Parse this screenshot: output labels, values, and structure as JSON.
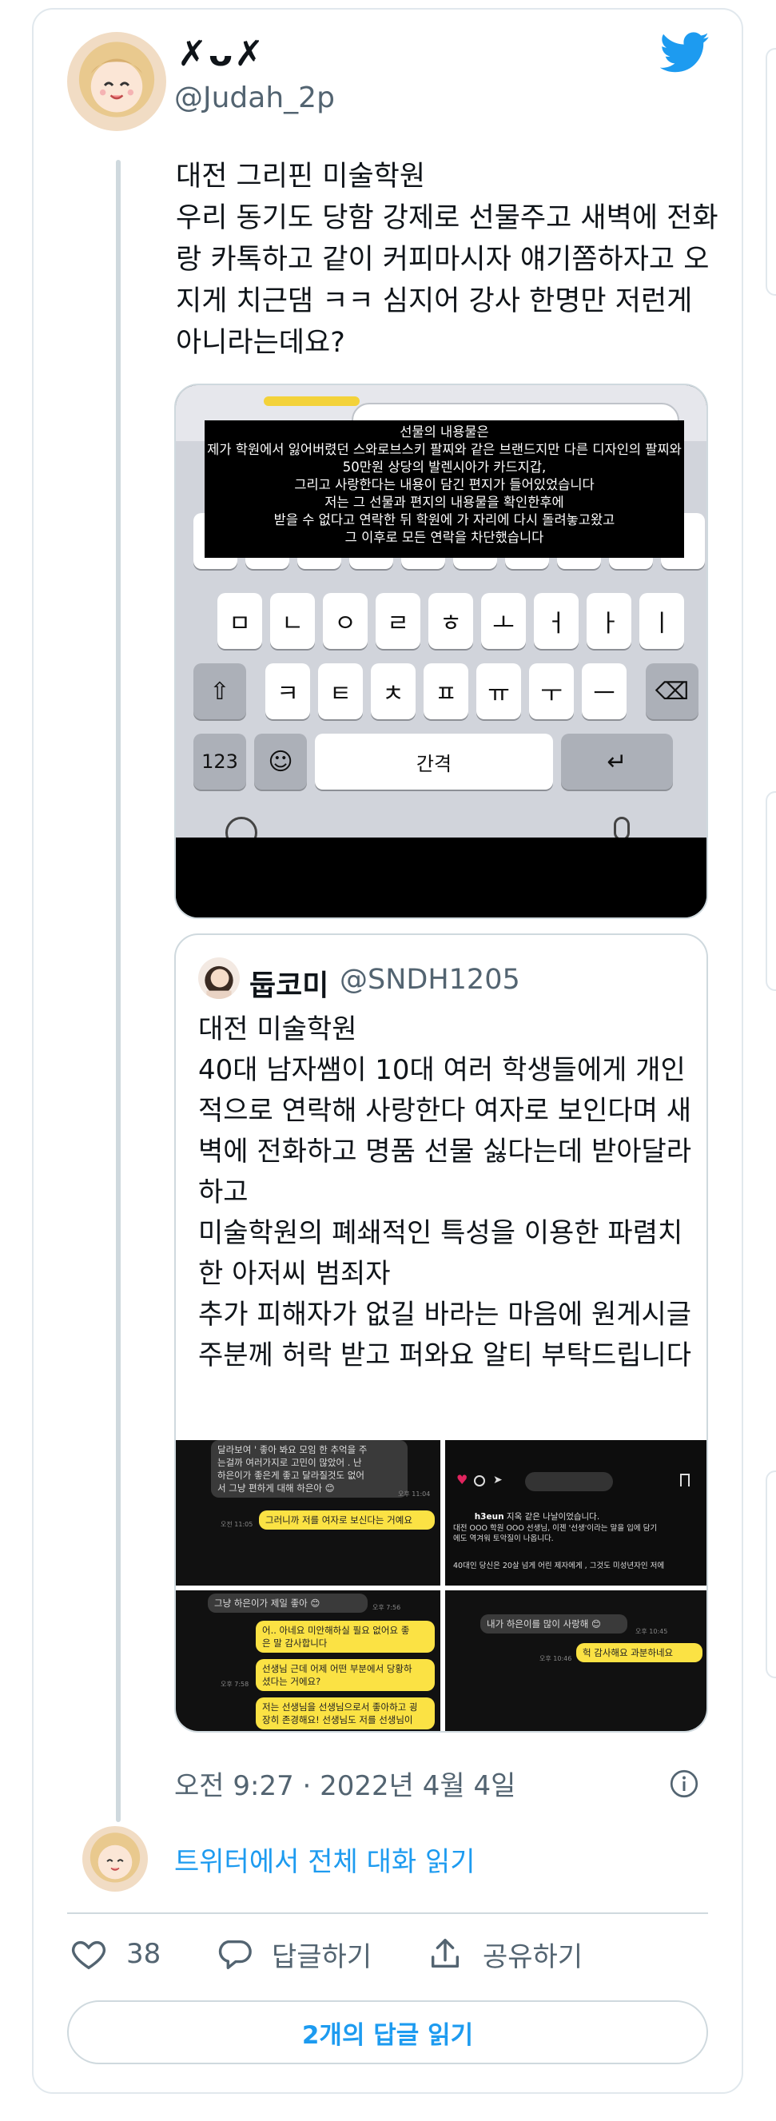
{
  "author": {
    "display_name": "✗ᴗ✗",
    "handle": "@Judah_2p"
  },
  "tweet": {
    "text": "대전 그리핀 미술학원\n우리 동기도 당함 강제로 선물주고 새벽에 전화랑 카톡하고 같이 커피마시자 얘기쫌하자고 오지게 치근댐 ㅋㅋ 심지어 강사 한명만 저런게 아니라는데요?"
  },
  "media": {
    "overlay_text": "선물의 내용물은\n제가 학원에서 잃어버렸던 스와로브스키 팔찌와 같은 브랜드지만 다른 디자인의 팔찌와 50만원 상당의 발렌시아가 카드지갑,\n그리고 사랑한다는 내용이 담긴 편지가 들어있었습니다\n저는 그 선물과 편지의 내용물을 확인한후에\n받을 수 없다고 연락한 뒤 학원에 가 자리에 다시 돌려놓고왔고\n그 이후로 모든 연락을 차단했습니다",
    "keyboard": {
      "row2": [
        "ㅁ",
        "ㄴ",
        "ㅇ",
        "ㄹ",
        "ㅎ",
        "ㅗ",
        "ㅓ",
        "ㅏ",
        "ㅣ"
      ],
      "row3": [
        "ㅋ",
        "ㅌ",
        "ㅊ",
        "ㅍ",
        "ㅠ",
        "ㅜ",
        "ㅡ"
      ],
      "num_key": "123",
      "space_key": "간격"
    }
  },
  "quote": {
    "name": "둡코미",
    "handle": "@SNDH1205",
    "text": "대전 미술학원\n40대 남자쌤이 10대 여러 학생들에게 개인적으로 연락해 사랑한다 여자로 보인다며 새벽에 전화하고 명품 선물 싫다는데 받아달라하고\n미술학원의 폐쇄적인 특성을 이용한 파렴치한 아저씨 범죄자\n추가 피해자가 없길 바라는 마음에 원게시글주분께 허락 받고 퍼와요 알티 부탁드립니다",
    "shots": {
      "s1_gray": "달라보여 ' 좋아 봐요 모임 한 추억을 주\n는걸까 여러가지로 고민이 많았어 . 난\n하은이가 좋은게 좋고 달라질것도 없어\n서 그냥 편하게 대해 하은아 😊",
      "s1_time": "오후 11:04",
      "s1_yellow": "그러니까 저를 여자로 보신다는 거예요",
      "s1_time2": "오전 11:05",
      "s2_user": "h3eun",
      "s2_line1": "지옥 같은 나날이었습니다.",
      "s2_line2": "대전 OOO 학원 OOO 선생님, 이젠 '선생'이라는 말을 입에 담기\n에도 역겨워 토악질이 나옵니다.",
      "s2_line3": "40대인 당신은 20살 넘게 어린 제자에게 , 그것도 미성년자인 저에",
      "s3_gray": "그냥 하은이가 제일 좋아 😊",
      "s3_time": "오후 7:56",
      "s3_y1": "어.. 아네요 미안해하실 필요 없어요 좋\n은 말 감사합니다",
      "s3_y2": "선생님 근데 어제 어떤 부분에서 당황하\n셨다는 거에요?",
      "s3_y3": "저는 선생님을 선생님으로서 좋아하고 굉\n장히 존경해요! 선생님도 저를 선생님이",
      "s3_time2": "오후 7:58",
      "s4_gray": "내가 하은이를 많이 사랑해 😊",
      "s4_time": "오후 10:45",
      "s4_yellow": "헉 감사해요 과분하네요",
      "s4_time2": "오후 10:46"
    }
  },
  "meta": {
    "timestamp": "오전 9:27 · 2022년 4월 4일"
  },
  "read_conversation": "트위터에서 전체 대화 읽기",
  "actions": {
    "like_count": "38",
    "reply_label": "답글하기",
    "share_label": "공유하기"
  },
  "read_replies": "2개의 답글 읽기",
  "colors": {
    "accent": "#1d9bf0",
    "secondary_text": "#536471",
    "border": "#cfd9de"
  }
}
